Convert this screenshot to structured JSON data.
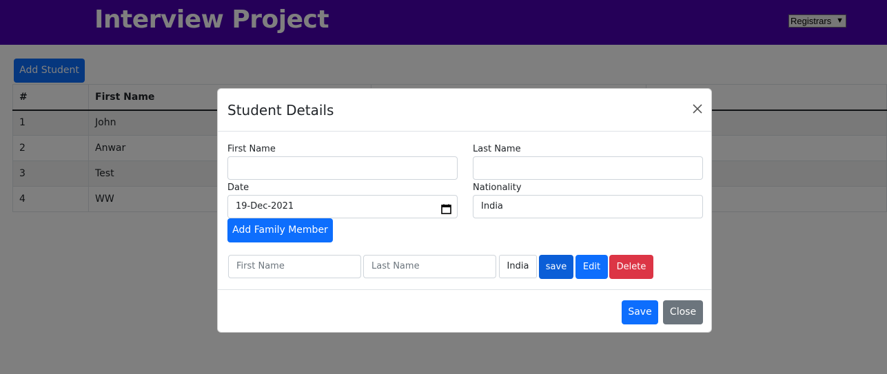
{
  "header": {
    "title": "Interview Project",
    "registrar_select": "Registrars"
  },
  "main": {
    "add_student_label": "Add Student",
    "table": {
      "columns": [
        "#",
        "First Name",
        "",
        ""
      ],
      "rows": [
        {
          "num": "1",
          "first": "John"
        },
        {
          "num": "2",
          "first": "Anwar"
        },
        {
          "num": "3",
          "first": "Test"
        },
        {
          "num": "4",
          "first": "WW"
        }
      ]
    }
  },
  "modal": {
    "title": "Student Details",
    "first_name_label": "First Name",
    "first_name_value": "",
    "last_name_label": "Last Name",
    "last_name_value": "",
    "date_label": "Date",
    "date_value": "19-Dec-2021",
    "nationality_label": "Nationality",
    "nationality_value": "India",
    "add_family_label": "Add Family Member",
    "family_row": {
      "first_placeholder": "First Name",
      "last_placeholder": "Last Name",
      "nationality": "India",
      "save_label": "save",
      "edit_label": "Edit",
      "delete_label": "Delete"
    },
    "save_label": "Save",
    "close_label": "Close"
  },
  "icons": {
    "close": "close-icon",
    "calendar": "calendar-icon",
    "select_chevron": "chevron-down-icon"
  },
  "colors": {
    "navbar": "#4b00b0",
    "primary": "#0d6efd",
    "danger": "#dc3545",
    "secondary": "#6c757d"
  }
}
